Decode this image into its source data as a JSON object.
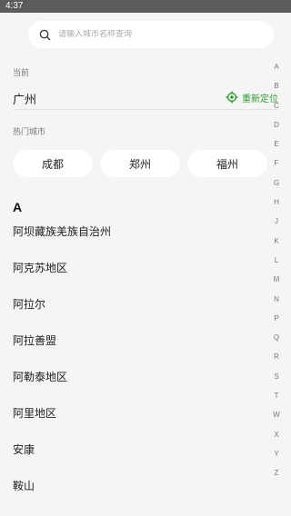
{
  "status_bar": {
    "time": "4:37"
  },
  "search": {
    "placeholder": "请输入城市名称查询",
    "value": ""
  },
  "current": {
    "label": "当前",
    "city": "广州",
    "relocate_label": "重新定位",
    "relocate_icon": "locate-icon"
  },
  "hot": {
    "label": "热门城市",
    "cities": [
      "成都",
      "郑州",
      "福州"
    ]
  },
  "section_letter": "A",
  "cities": [
    "阿坝藏族羌族自治州",
    "阿克苏地区",
    "阿拉尔",
    "阿拉善盟",
    "阿勒泰地区",
    "阿里地区",
    "安康",
    "鞍山"
  ],
  "index_letters": [
    "A",
    "B",
    "C",
    "D",
    "E",
    "F",
    "G",
    "H",
    "J",
    "K",
    "L",
    "M",
    "N",
    "P",
    "Q",
    "R",
    "S",
    "T",
    "W",
    "X",
    "Y",
    "Z"
  ],
  "colors": {
    "accent": "#2e9b33",
    "background": "#f5f5f5",
    "status_bar": "#5b5b5b"
  }
}
